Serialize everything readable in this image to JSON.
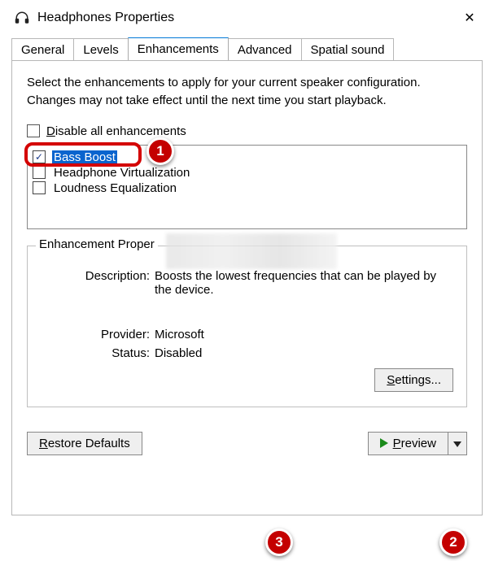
{
  "window": {
    "title": "Headphones Properties",
    "close": "✕"
  },
  "tabs": {
    "items": [
      {
        "label": "General"
      },
      {
        "label": "Levels"
      },
      {
        "label": "Enhancements"
      },
      {
        "label": "Advanced"
      },
      {
        "label": "Spatial sound"
      }
    ],
    "activeIndex": 2
  },
  "intro": "Select the enhancements to apply for your current speaker configuration. Changes may not take effect until the next time you start playback.",
  "disable_all": {
    "prefix": "D",
    "rest": "isable all enhancements",
    "checked": false
  },
  "enhancements": [
    {
      "label": "Bass Boost",
      "checked": true,
      "selected": true
    },
    {
      "label": "Headphone Virtualization",
      "checked": false,
      "selected": false
    },
    {
      "label": "Loudness Equalization",
      "checked": false,
      "selected": false
    }
  ],
  "group": {
    "title": "Enhancement Proper",
    "description_k": "Description:",
    "description_v": "Boosts the lowest frequencies that can be played by the device.",
    "provider_k": "Provider:",
    "provider_v": "Microsoft",
    "status_k": "Status:",
    "status_v": "Disabled",
    "settings_u": "S",
    "settings_rest": "ettings..."
  },
  "buttons": {
    "restore_u": "R",
    "restore_rest": "estore Defaults",
    "preview_u": "P",
    "preview_rest": "review"
  },
  "annotations": {
    "1": "1",
    "2": "2",
    "3": "3"
  }
}
